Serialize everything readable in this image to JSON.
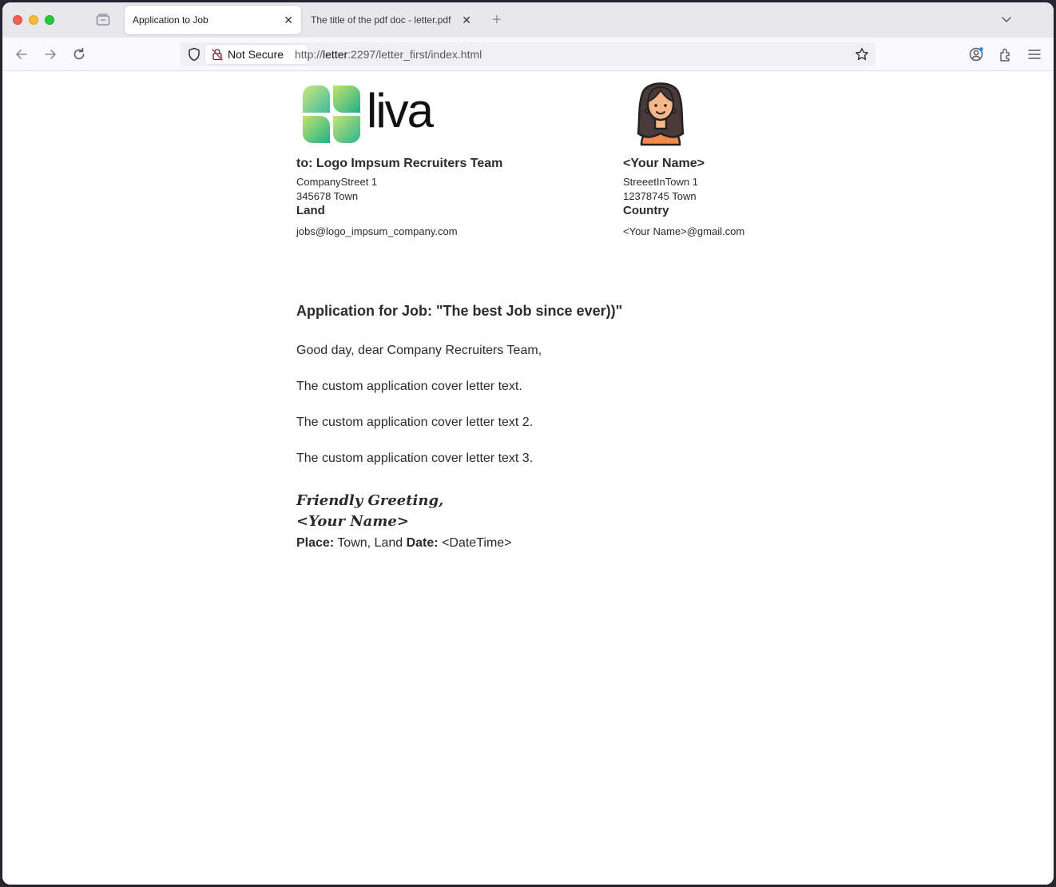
{
  "browser": {
    "tabs": [
      {
        "title": "Application to Job",
        "active": true
      },
      {
        "title": "The title of the pdf doc - letter.pdf",
        "active": false
      }
    ],
    "close_glyph": "✕",
    "new_tab_glyph": "+",
    "security_label": "Not Secure",
    "url_prefix": "http://",
    "url_host": "letter",
    "url_rest": ":2297/letter_first/index.html"
  },
  "letter": {
    "logo_text": "liva",
    "recipient": {
      "heading": "to: Logo Impsum Recruiters Team",
      "street": "CompanyStreet 1",
      "zip_town": "345678  Town",
      "country": "Land",
      "email": "jobs@logo_impsum_company.com"
    },
    "sender": {
      "heading": "<Your Name>",
      "street": "StreeetInTown 1",
      "zip_town": "12378745  Town",
      "country": "Country",
      "email": "<Your Name>@gmail.com"
    },
    "subject": "Application for Job: \"The best Job since ever))\"",
    "salutation": "Good day, dear Company Recruiters Team,",
    "paragraphs": [
      "The custom application cover letter text.",
      "The custom application cover letter text 2.",
      "The custom application cover letter text 3."
    ],
    "closing": "Friendly Greeting,",
    "signature": "<Your Name>",
    "place_label": "Place:",
    "place_value": "Town, Land",
    "date_label": "Date:",
    "date_value": "<DateTime>"
  },
  "colors": {
    "logo_green_light": "#9fd36a",
    "logo_green_dark": "#1fb08a",
    "avatar_shirt": "#f28a4b",
    "avatar_skin": "#f6b88a",
    "avatar_hair": "#4a3a3a"
  }
}
